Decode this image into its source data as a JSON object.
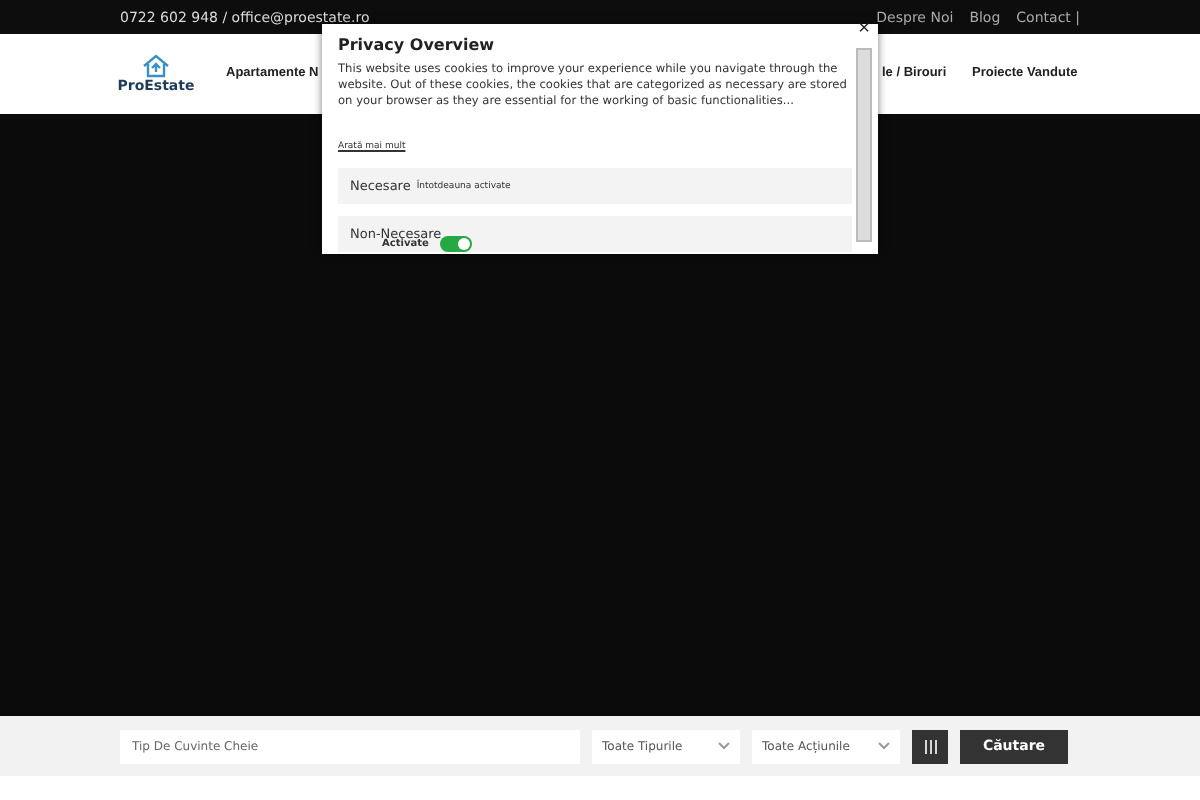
{
  "top_bar": {
    "contact": "0722 602 948 / office@proestate.ro",
    "links": [
      "Despre Noi",
      "Blog",
      "Contact |"
    ]
  },
  "header": {
    "logo": "ProEstate",
    "nav": [
      "Apartamente N",
      "le / Birouri",
      "Proiecte Vandute"
    ]
  },
  "search": {
    "placeholder": "Tip De Cuvinte Cheie",
    "selects": [
      "Toate Tipurile",
      "Toate Acțiunile"
    ],
    "button": "Căutare"
  },
  "modal": {
    "title": "Privacy Overview",
    "close": "×",
    "text": "This website uses cookies to improve your experience while you navigate through the website. Out of these cookies, the cookies that are categorized as necessary are stored on your browser as they are essential for the working of basic functionalities...",
    "more": "Arată mai mult",
    "sections": [
      {
        "kind": "always",
        "title": "Necesare",
        "note": "Întotdeauna activate"
      },
      {
        "kind": "toggle",
        "title": "Non-Necesare",
        "note": "Activate",
        "on": true
      }
    ]
  }
}
